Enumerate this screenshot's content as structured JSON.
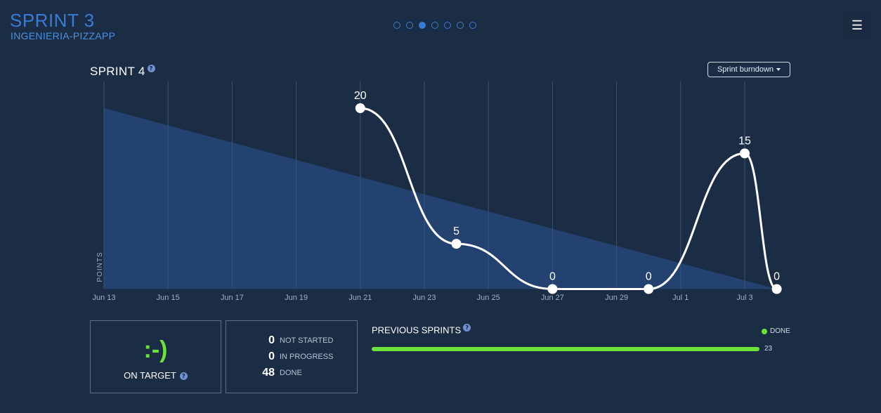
{
  "header": {
    "title": "SPRINT 3",
    "subtitle": "INGENIERIA-PIZZAPP",
    "pager": {
      "count": 7,
      "active_index": 2
    },
    "menu_icon": "hamburger-icon"
  },
  "chart_panel": {
    "title": "SPRINT 4",
    "help_icon": "?",
    "select_label": "Sprint burndown"
  },
  "chart_data": {
    "type": "line",
    "ylabel": "POINTS",
    "x_ticks": [
      "Jun 13",
      "Jun 15",
      "Jun 17",
      "Jun 19",
      "Jun 21",
      "Jun 23",
      "Jun 25",
      "Jun 27",
      "Jun 29",
      "Jul 1",
      "Jul 3"
    ],
    "ideal_area": {
      "start": [
        "Jun 13",
        20
      ],
      "end": [
        "Jul 4",
        0
      ]
    },
    "series": [
      {
        "points": [
          {
            "x": "Jun 21",
            "y": 20,
            "label": "20"
          },
          {
            "x": "Jun 24",
            "y": 5,
            "label": "5"
          },
          {
            "x": "Jun 27",
            "y": 0,
            "label": "0"
          },
          {
            "x": "Jun 30",
            "y": 0,
            "label": "0"
          },
          {
            "x": "Jul 3",
            "y": 15,
            "label": "15"
          },
          {
            "x": "Jul 4",
            "y": 0,
            "label": "0"
          }
        ]
      }
    ],
    "ylim": [
      0,
      23
    ],
    "colors": {
      "area": "#24426f",
      "line": "#ffffff",
      "grid": "#3a5272",
      "tick": "#9eb0c6"
    }
  },
  "status": {
    "emoticon": ":-)",
    "label": "ON TARGET"
  },
  "counts": [
    {
      "value": "0",
      "label": "NOT STARTED"
    },
    {
      "value": "0",
      "label": "IN PROGRESS"
    },
    {
      "value": "48",
      "label": "DONE"
    }
  ],
  "previous_sprints": {
    "title": "PREVIOUS SPRINTS",
    "legend_label": "DONE",
    "bars": [
      {
        "value": "23",
        "fraction": 1.0
      }
    ],
    "colors": {
      "done": "#6ce33a"
    }
  }
}
